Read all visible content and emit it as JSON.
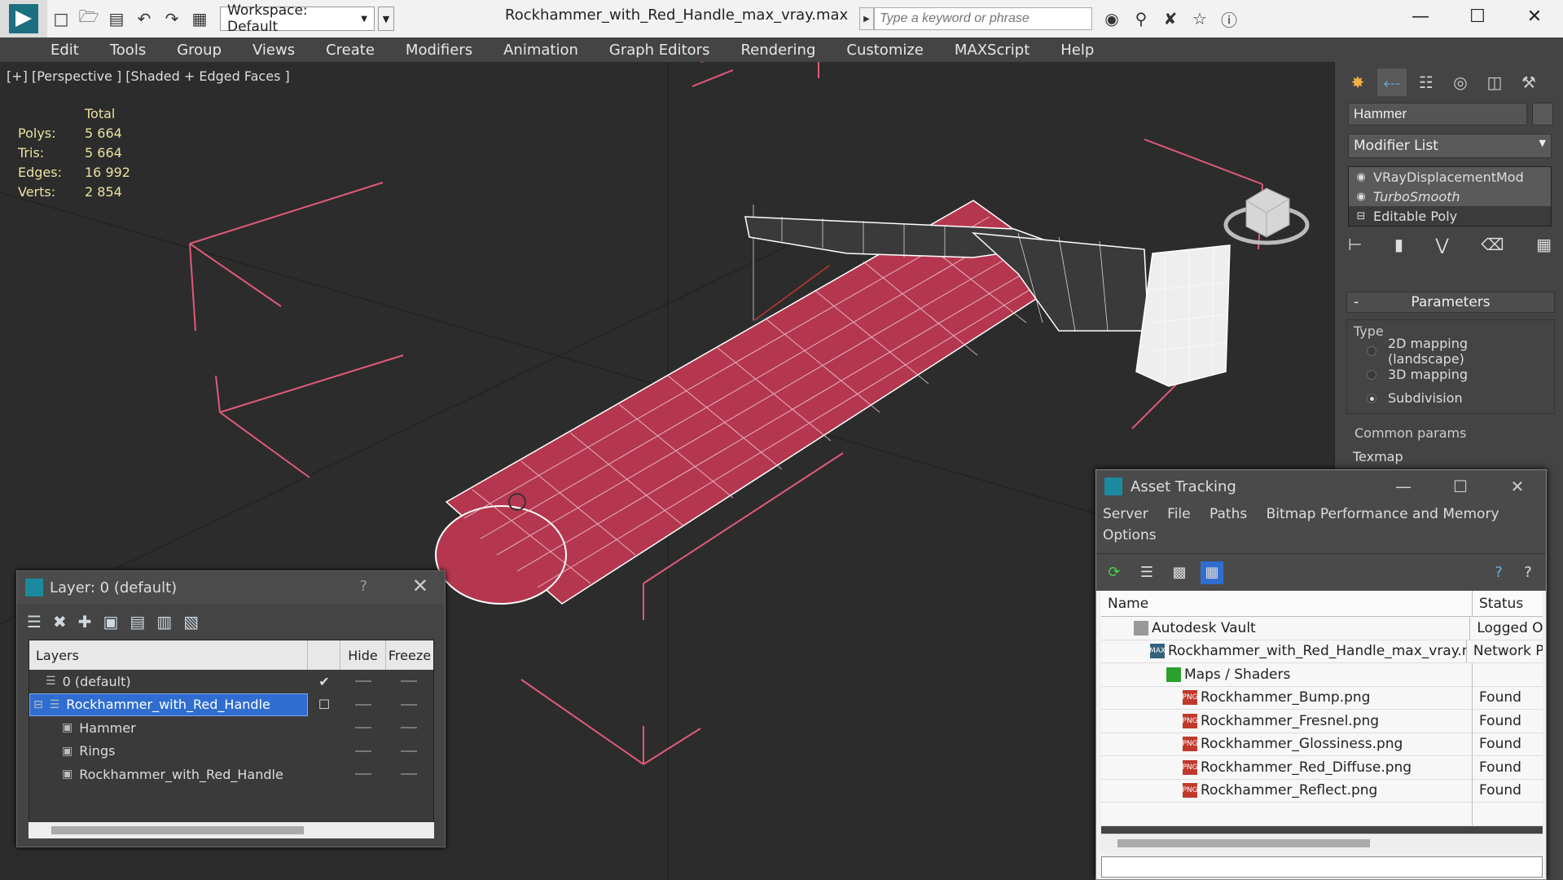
{
  "titlebar": {
    "workspace_label": "Workspace: Default",
    "document_title": "Rockhammer_with_Red_Handle_max_vray.max",
    "search_placeholder": "Type a keyword or phrase"
  },
  "menu": [
    "Edit",
    "Tools",
    "Group",
    "Views",
    "Create",
    "Modifiers",
    "Animation",
    "Graph Editors",
    "Rendering",
    "Customize",
    "MAXScript",
    "Help"
  ],
  "viewport": {
    "label": "[+] [Perspective ] [Shaded + Edged Faces ]",
    "stats_header": "Total",
    "stats": [
      {
        "k": "Polys:",
        "v": "5 664"
      },
      {
        "k": "Tris:",
        "v": "5 664"
      },
      {
        "k": "Edges:",
        "v": "16 992"
      },
      {
        "k": "Verts:",
        "v": "2 854"
      }
    ],
    "colors": {
      "handle": "#b5374f",
      "wire": "#ffffff",
      "bbox": "#e05a78"
    }
  },
  "command_panel": {
    "object_name": "Hammer",
    "modifier_list_label": "Modifier List",
    "stack": [
      {
        "label": "VRayDisplacementMod",
        "italic": false
      },
      {
        "label": "TurboSmooth",
        "italic": true
      },
      {
        "label": "Editable Poly",
        "italic": false
      }
    ],
    "params_title": "Parameters",
    "params_minus": "-",
    "type_label": "Type",
    "radios": [
      {
        "label": "2D mapping (landscape)",
        "on": false
      },
      {
        "label": "3D mapping",
        "on": false
      },
      {
        "label": "Subdivision",
        "on": true
      }
    ],
    "common_params": "Common params",
    "texmap": "Texmap"
  },
  "layer_dialog": {
    "title": "Layer: 0 (default)",
    "help": "?",
    "columns": {
      "layers": "Layers",
      "hide": "Hide",
      "freeze": "Freeze"
    },
    "rows": [
      {
        "name": "0 (default)",
        "indent": 1,
        "checked": true,
        "selected": false
      },
      {
        "name": "Rockhammer_with_Red_Handle",
        "indent": 1,
        "checked": false,
        "selected": true
      },
      {
        "name": "Hammer",
        "indent": 2,
        "checked": false,
        "selected": false
      },
      {
        "name": "Rings",
        "indent": 2,
        "checked": false,
        "selected": false
      },
      {
        "name": "Rockhammer_with_Red_Handle",
        "indent": 2,
        "checked": false,
        "selected": false
      }
    ]
  },
  "asset_dialog": {
    "title": "Asset Tracking",
    "menu": [
      "Server",
      "File",
      "Paths",
      "Bitmap Performance and Memory",
      "Options"
    ],
    "columns": {
      "name": "Name",
      "status": "Status"
    },
    "rows": [
      {
        "name": "Autodesk Vault",
        "status": "Logged O",
        "indent": 40,
        "icon": "vault-icon"
      },
      {
        "name": "Rockhammer_with_Red_Handle_max_vray.max",
        "status": "Network P",
        "indent": 60,
        "icon": "max-file-icon"
      },
      {
        "name": "Maps / Shaders",
        "status": "",
        "indent": 80,
        "icon": "maps-icon"
      },
      {
        "name": "Rockhammer_Bump.png",
        "status": "Found",
        "indent": 100,
        "icon": "png-icon"
      },
      {
        "name": "Rockhammer_Fresnel.png",
        "status": "Found",
        "indent": 100,
        "icon": "png-icon"
      },
      {
        "name": "Rockhammer_Glossiness.png",
        "status": "Found",
        "indent": 100,
        "icon": "png-icon"
      },
      {
        "name": "Rockhammer_Red_Diffuse.png",
        "status": "Found",
        "indent": 100,
        "icon": "png-icon"
      },
      {
        "name": "Rockhammer_Reflect.png",
        "status": "Found",
        "indent": 100,
        "icon": "png-icon"
      }
    ]
  }
}
